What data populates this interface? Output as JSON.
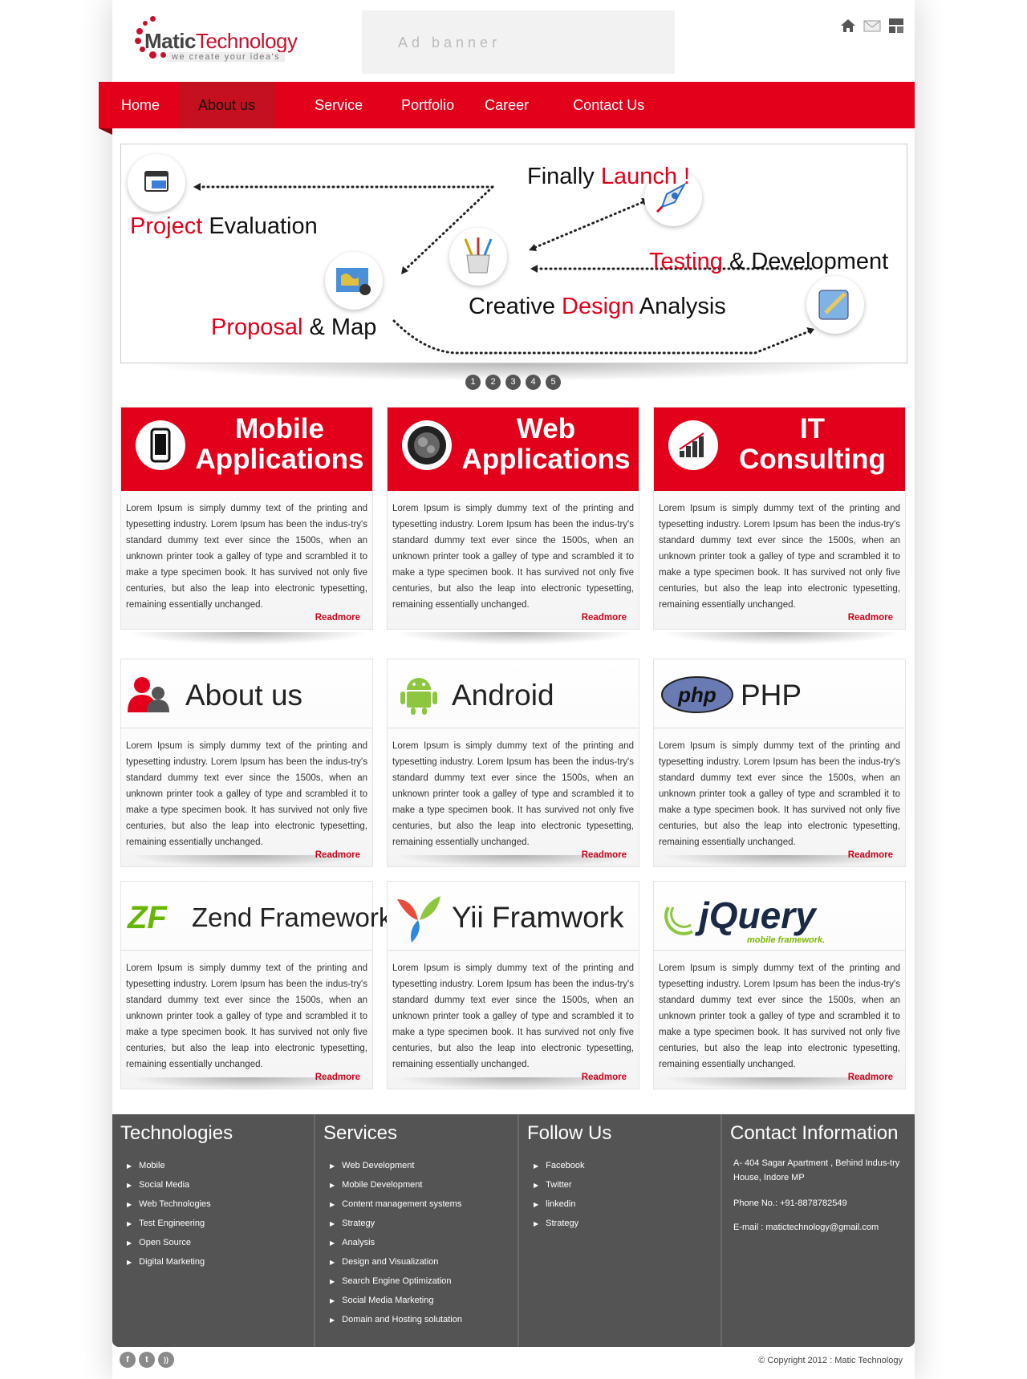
{
  "header": {
    "logo_brand": "Matic",
    "logo_word": "Technology",
    "logo_tagline": "we create your idea's",
    "ad_banner": "Ad banner",
    "icons": [
      "home-icon",
      "mail-icon",
      "sitemap-icon"
    ]
  },
  "nav": {
    "items": [
      {
        "label": "Home",
        "active": false
      },
      {
        "label": "About us",
        "active": true
      },
      {
        "label": "Service",
        "active": false
      },
      {
        "label": "Portfolio",
        "active": false
      },
      {
        "label": "Career",
        "active": false
      },
      {
        "label": "Contact Us",
        "active": false
      }
    ]
  },
  "slider": {
    "steps": [
      {
        "red": "Project",
        "dark": " Evaluation"
      },
      {
        "red": "Proposal",
        "dark": " & Map"
      },
      {
        "red": "",
        "dark": "Creative ",
        "red2": "Design",
        "dark2": " Analysis"
      },
      {
        "red": "Testing",
        "dark": " & Development"
      },
      {
        "dark": "Finally ",
        "red2": "Launch !"
      }
    ],
    "pages": [
      "1",
      "2",
      "3",
      "4",
      "5"
    ]
  },
  "services": [
    {
      "title_line1": "Mobile",
      "title_line2": "Applications",
      "icon": "mobile-phone-icon"
    },
    {
      "title_line1": "Web",
      "title_line2": "Applications",
      "icon": "gears-icon"
    },
    {
      "title_line1": "IT",
      "title_line2": "Consulting",
      "icon": "bar-chart-icon"
    }
  ],
  "tech": [
    {
      "title": "About us",
      "icon": "users-icon"
    },
    {
      "title": "Android",
      "icon": "android-icon"
    },
    {
      "title": "PHP",
      "icon": "php-logo-icon",
      "logo_text": "php"
    },
    {
      "title": "Zend Framework",
      "icon": "zend-logo-icon",
      "logo_text": "ZF"
    },
    {
      "title": "Yii Framwork",
      "icon": "yii-logo-icon"
    },
    {
      "title": "jQuery",
      "icon": "jquery-logo-icon",
      "logo_sub": "mobile framework."
    }
  ],
  "lorem": "Lorem Ipsum is simply dummy text of the printing and typesetting industry. Lorem Ipsum has been the indus-try's standard dummy text ever since the 1500s, when an unknown printer took a galley of type and scrambled it to make a type specimen book. It has survived not only five centuries, but also the leap into electronic typesetting, remaining essentially unchanged.",
  "readmore": "Readmore",
  "footer": {
    "technologies": {
      "title": "Technologies",
      "items": [
        "Mobile",
        "Social Media",
        "Web Technologies",
        "Test Engineering",
        "Open Source",
        "Digital Marketing"
      ]
    },
    "services": {
      "title": "Services",
      "items": [
        "Web Development",
        "Mobile Development",
        "Content management systems",
        "Strategy",
        "Analysis",
        "Design and Visualization",
        "Search Engine Optimization",
        "Social Media Marketing",
        "Domain and Hosting solutation"
      ]
    },
    "follow": {
      "title": "Follow Us",
      "items": [
        "Facebook",
        "Twitter",
        "linkedin",
        "Strategy"
      ]
    },
    "contact": {
      "title": "Contact Information",
      "address": "A- 404 Sagar Apartment , Behind Indus-try House, Indore MP",
      "phone": "Phone No.: +91-8878782549",
      "email": "E-mail : matictechnology@gmail.com"
    }
  },
  "bottom": {
    "social": [
      "f",
      "t",
      "rss"
    ],
    "copyright": "© Copyright 2012 : Matic Technology"
  },
  "colors": {
    "accent": "#e2001a",
    "footer_bg": "#545454"
  }
}
